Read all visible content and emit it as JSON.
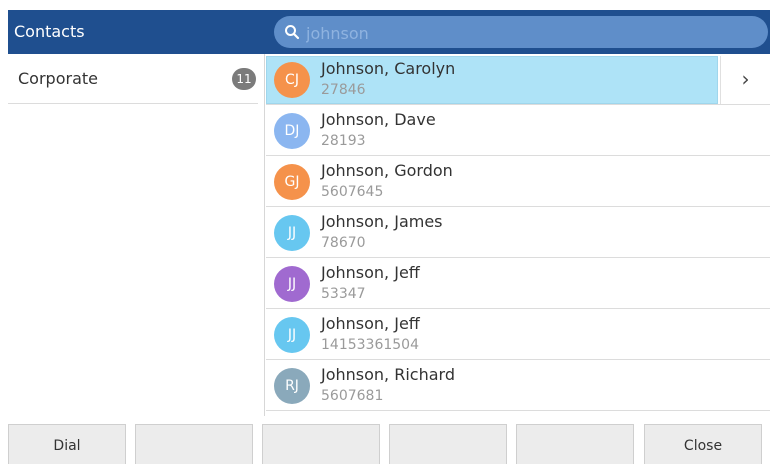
{
  "header": {
    "title": "Contacts",
    "search": {
      "value": "",
      "placeholder": "johnson"
    }
  },
  "sidebar": {
    "groups": [
      {
        "label": "Corporate",
        "count": "11"
      }
    ]
  },
  "contacts": [
    {
      "initials": "CJ",
      "name": "Johnson, Carolyn",
      "number": "27846",
      "color": "#f5924b",
      "selected": true
    },
    {
      "initials": "DJ",
      "name": "Johnson, Dave",
      "number": "28193",
      "color": "#8bb6f0"
    },
    {
      "initials": "GJ",
      "name": "Johnson, Gordon",
      "number": "5607645",
      "color": "#f5924b"
    },
    {
      "initials": "JJ",
      "name": "Johnson, James",
      "number": "78670",
      "color": "#67c7f0"
    },
    {
      "initials": "JJ",
      "name": "Johnson, Jeff",
      "number": "53347",
      "color": "#a06ad0"
    },
    {
      "initials": "JJ",
      "name": "Johnson, Jeff",
      "number": "14153361504",
      "color": "#67c7f0"
    },
    {
      "initials": "RJ",
      "name": "Johnson, Richard",
      "number": "5607681",
      "color": "#8aa9bb"
    }
  ],
  "softkeys": [
    "Dial",
    "",
    "",
    "",
    "",
    "Close"
  ],
  "icons": {
    "search": "search-icon",
    "chevron": "chevron-right-icon"
  }
}
